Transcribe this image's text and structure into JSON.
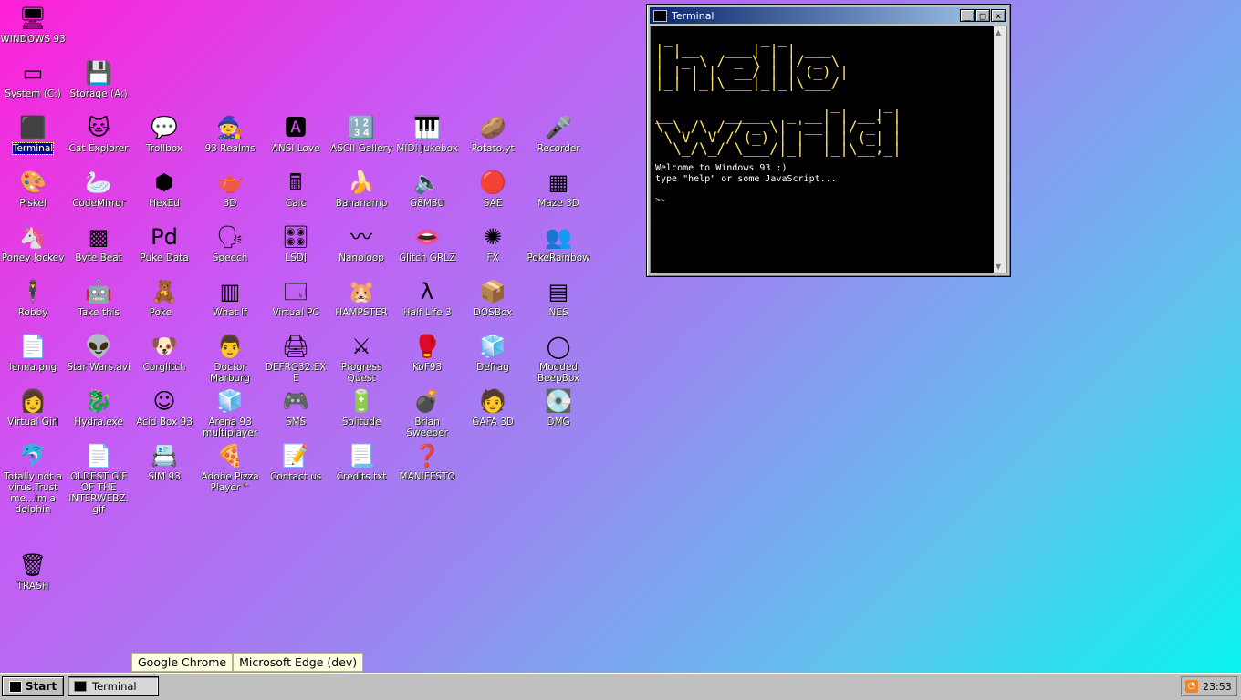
{
  "desktop": {
    "icons": [
      {
        "label": "WINDOWS 93",
        "glyph": "🖥",
        "icon": "computer-icon"
      },
      {
        "label": "System (C:)",
        "glyph": "▭",
        "icon": "drive-icon"
      },
      {
        "label": "Storage (A:)",
        "glyph": "💾",
        "icon": "floppy-drive-icon"
      },
      {
        "label": "Terminal",
        "glyph": "⬛",
        "icon": "terminal-icon",
        "selected": true
      },
      {
        "label": "Cat Explorer",
        "glyph": "🐱",
        "icon": "cat-explorer-icon"
      },
      {
        "label": "Trollbox",
        "glyph": "💬",
        "icon": "trollbox-icon"
      },
      {
        "label": "93 Realms",
        "glyph": "🧙",
        "icon": "realms-icon"
      },
      {
        "label": "ANSI Love",
        "glyph": "🅰",
        "icon": "ansi-love-icon"
      },
      {
        "label": "ASCII Gallery",
        "glyph": "🔢",
        "icon": "ascii-gallery-icon"
      },
      {
        "label": "MIDI Jukebox",
        "glyph": "🎹",
        "icon": "midi-jukebox-icon"
      },
      {
        "label": "Potato.yt",
        "glyph": "🥔",
        "icon": "potato-icon"
      },
      {
        "label": "Recorder",
        "glyph": "🎤",
        "icon": "microphone-icon"
      },
      {
        "label": "Piskel",
        "glyph": "🎨",
        "icon": "palette-icon"
      },
      {
        "label": "CodeMirror",
        "glyph": "🦢",
        "icon": "codemirror-icon"
      },
      {
        "label": "HexEd",
        "glyph": "⬢",
        "icon": "hexagon-icon"
      },
      {
        "label": "3D",
        "glyph": "🫖",
        "icon": "teapot-icon"
      },
      {
        "label": "Calc",
        "glyph": "🖩",
        "icon": "calculator-icon"
      },
      {
        "label": "Bananamp",
        "glyph": "🍌",
        "icon": "banana-icon"
      },
      {
        "label": "G8̃M3U",
        "glyph": "🔈",
        "icon": "speaker-icon"
      },
      {
        "label": "SAE",
        "glyph": "🔴",
        "icon": "amiga-ball-icon"
      },
      {
        "label": "Maze 3D",
        "glyph": "▦",
        "icon": "maze-icon"
      },
      {
        "label": "Poney Jockey",
        "glyph": "🦄",
        "icon": "pony-icon"
      },
      {
        "label": "Byte Beat",
        "glyph": "▩",
        "icon": "byte-beat-icon"
      },
      {
        "label": "Puke Data",
        "glyph": "Pd",
        "icon": "pure-data-icon"
      },
      {
        "label": "Speech",
        "glyph": "🗣",
        "icon": "speech-icon"
      },
      {
        "label": "LSDJ",
        "glyph": "🎛",
        "icon": "lsdj-icon"
      },
      {
        "label": "Nanoloop",
        "glyph": "〰",
        "icon": "nanoloop-icon"
      },
      {
        "label": "Glitch GRLZ",
        "glyph": "👄",
        "icon": "lips-icon"
      },
      {
        "label": "FX",
        "glyph": "✺",
        "icon": "fx-icon"
      },
      {
        "label": "PokéRainbow",
        "glyph": "👥",
        "icon": "pokerainbow-icon"
      },
      {
        "label": "Robby",
        "glyph": "🕴",
        "icon": "robot-icon"
      },
      {
        "label": "Take this",
        "glyph": "🤖",
        "icon": "take-this-icon"
      },
      {
        "label": "Poke    ",
        "glyph": "🧸",
        "icon": "poke-icon"
      },
      {
        "label": "What If",
        "glyph": "▥",
        "icon": "what-if-icon"
      },
      {
        "label": "Virtual PC",
        "glyph": "🗔",
        "icon": "virtual-pc-icon"
      },
      {
        "label": "HAMPSTER",
        "glyph": "🐹",
        "icon": "hamster-icon"
      },
      {
        "label": "Half-Life 3",
        "glyph": "λ",
        "icon": "half-life-icon"
      },
      {
        "label": "DOSBox",
        "glyph": "📦",
        "icon": "dosbox-icon"
      },
      {
        "label": "NES",
        "glyph": "▤",
        "icon": "nes-icon"
      },
      {
        "label": "lenna.png",
        "glyph": "📄",
        "icon": "image-file-icon"
      },
      {
        "label": "Star Wars.avi",
        "glyph": "👽",
        "icon": "yoda-icon"
      },
      {
        "label": "Corglitch",
        "glyph": "🐶",
        "icon": "corgi-icon"
      },
      {
        "label": "Doctor Marburg",
        "glyph": "👨",
        "icon": "doctor-icon"
      },
      {
        "label": "DEFRG32.EXE",
        "glyph": "🖨",
        "icon": "defrag-exe-icon"
      },
      {
        "label": "Progress Quest",
        "glyph": "⚔",
        "icon": "progress-quest-icon"
      },
      {
        "label": "KoF93",
        "glyph": "🥊",
        "icon": "kof-icon"
      },
      {
        "label": "Defrag",
        "glyph": "🧊",
        "icon": "defrag-icon"
      },
      {
        "label": "Modded BeepBox",
        "glyph": "◯",
        "icon": "beepbox-icon"
      },
      {
        "label": "Virtual Girl",
        "glyph": "👩",
        "icon": "virtual-girl-icon"
      },
      {
        "label": "Hydra.exe",
        "glyph": "🐉",
        "icon": "hydra-icon"
      },
      {
        "label": "Acid Box 93",
        "glyph": "☺",
        "icon": "smiley-icon"
      },
      {
        "label": "Arena 93 multiplayer",
        "glyph": "🧊",
        "icon": "arena-icon"
      },
      {
        "label": "SMS",
        "glyph": "🎮",
        "icon": "sms-icon"
      },
      {
        "label": "Solitude",
        "glyph": "🔋",
        "icon": "solitude-icon"
      },
      {
        "label": "Brian Sweeper",
        "glyph": "💣",
        "icon": "bomb-icon"
      },
      {
        "label": "GAFA 3D",
        "glyph": "🧑",
        "icon": "gafa-icon"
      },
      {
        "label": "DMG",
        "glyph": "💽",
        "icon": "dmg-icon"
      },
      {
        "label": "Totally not a virus.Trust me...im a dolphin",
        "glyph": "🐬",
        "icon": "dolphin-icon"
      },
      {
        "label": "OLDEST GIF OF THE INTERWEBZ.gif",
        "glyph": "📄",
        "icon": "gif-file-icon"
      },
      {
        "label": "SIM 93",
        "glyph": "📇",
        "icon": "sim-icon"
      },
      {
        "label": "Adobe Pizza Player™",
        "glyph": "🍕",
        "icon": "pizza-icon"
      },
      {
        "label": "Contact us",
        "glyph": "📝",
        "icon": "contact-icon"
      },
      {
        "label": "Credits.txt",
        "glyph": "📃",
        "icon": "text-file-icon"
      },
      {
        "label": "MANIFESTO",
        "glyph": "❓",
        "icon": "question-icon"
      },
      {
        "label": "TRASH",
        "glyph": "🗑",
        "icon": "trash-icon"
      }
    ]
  },
  "terminal": {
    "title": "Terminal",
    "minimize": "_",
    "maximize": "□",
    "close": "✕",
    "ascii_art": " _          _ _\n| |__   ___| | | ___\n| '_ \\ / _ \\ | |/ _ \\\n| | | |  __/ | | (_) |\n|_| |_|\\___|_|_|\\___/\n\n                    _     _\n__      _____  _ __| | __| |\n\\ \\ /\\ / / _ \\| '__| |/ _` |\n \\ V  V / (_) | |  | | (_| |\n  \\_/\\_/ \\___/|_|  |_|\\__,_|",
    "welcome_line": "Welcome to Windows 93 :)",
    "help_line": "type \"help\" or some JavaScript...",
    "prompt": ">~"
  },
  "tooltips": [
    "Google Chrome",
    "Microsoft Edge (dev)"
  ],
  "taskbar": {
    "start_label": "Start",
    "task_label": "Terminal",
    "clock": "23:53",
    "rss": "◔"
  }
}
